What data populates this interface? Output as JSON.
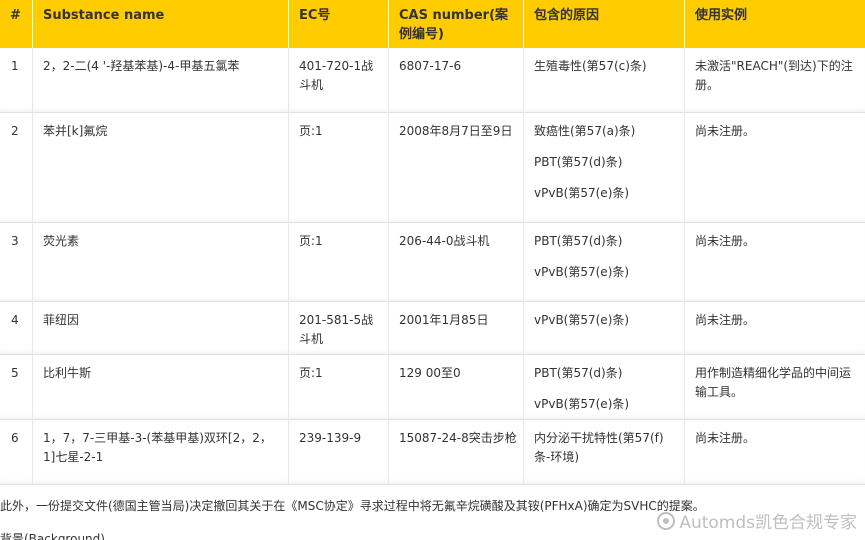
{
  "table": {
    "headers": {
      "num": "#",
      "name": "Substance name",
      "ec": "EC号",
      "cas": "CAS number(案例编号)",
      "reason": "包含的原因",
      "use": "使用实例"
    },
    "rows": [
      {
        "num": "1",
        "name": "2，2-二(4 '-羟基苯基)-4-甲基五氯苯",
        "ec": "401-720-1战斗机",
        "cas": "6807-17-6",
        "reasons": [
          "生殖毒性(第57(c)条)"
        ],
        "use": "未激活\"REACH\"(到达)下的注册。"
      },
      {
        "num": "2",
        "name": "苯并[k]氟烷",
        "ec": "页:1",
        "cas": "2008年8月7日至9日",
        "reasons": [
          "致癌性(第57(a)条)",
          "PBT(第57(d)条)",
          "vPvB(第57(e)条)"
        ],
        "use": "尚未注册。"
      },
      {
        "num": "3",
        "name": "荧光素",
        "ec": "页:1",
        "cas": "206-44-0战斗机",
        "reasons": [
          "PBT(第57(d)条)",
          "vPvB(第57(e)条)"
        ],
        "use": "尚未注册。"
      },
      {
        "num": "4",
        "name": "菲纽因",
        "ec": "201-581-5战斗机",
        "cas": "2001年1月85日",
        "reasons": [
          "vPvB(第57(e)条)"
        ],
        "use": "尚未注册。"
      },
      {
        "num": "5",
        "name": "比利牛斯",
        "ec": "页:1",
        "cas": "129 00至0",
        "reasons": [
          "PBT(第57(d)条)",
          "vPvB(第57(e)条)"
        ],
        "use": "用作制造精细化学品的中间运输工具。"
      },
      {
        "num": "6",
        "name": "1，7，7-三甲基-3-(苯基甲基)双环[2，2，1]七星-2-1",
        "ec": "239-139-9",
        "cas": "15087-24-8突击步枪",
        "reasons": [
          "内分泌干扰特性(第57(f)条-环境)"
        ],
        "use": "尚未注册。"
      }
    ]
  },
  "footer": {
    "note": "此外，一份提交文件(德国主管当局)决定撤回其关于在《MSC协定》寻求过程中将无氟辛烷磺酸及其铵(PFHxA)确定为SVHC的提案。",
    "next_heading": "背景(Background)"
  },
  "watermark": {
    "text": "Automds凯色合规专家",
    "icon": "weibo-icon"
  },
  "colors": {
    "header_bg": "#ffcc00",
    "text": "#333333",
    "row_border": "#e0e0e0"
  }
}
